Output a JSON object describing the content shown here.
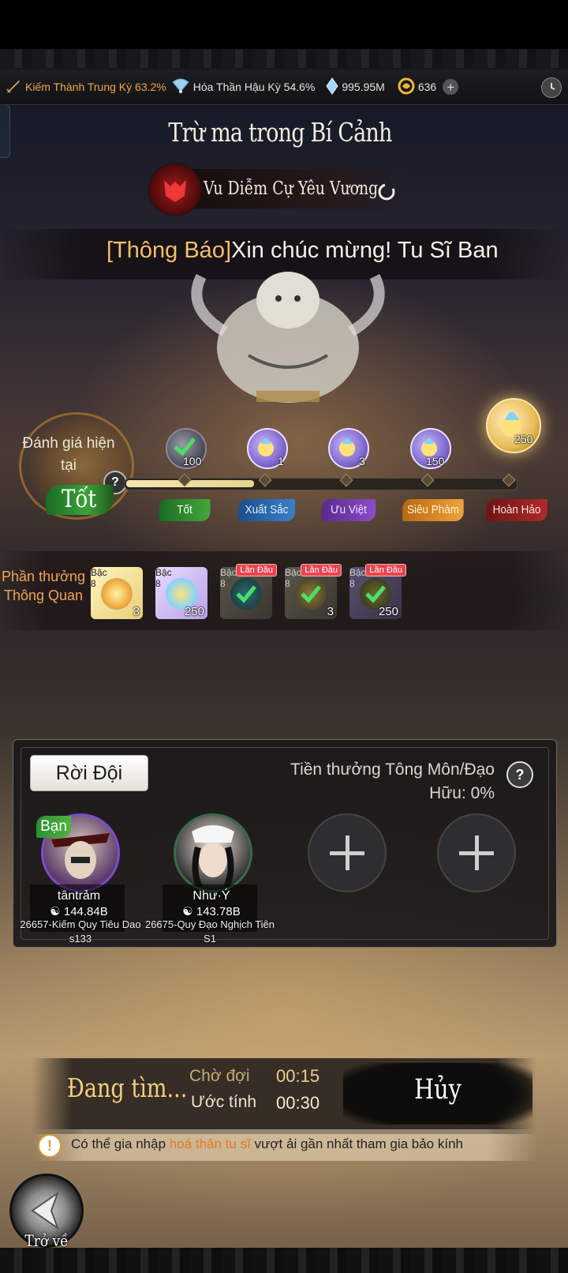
{
  "status": {
    "realm_1": "Kiếm Thành Trung Kỳ 63.2%",
    "realm_2": "Hóa Thần Hậu Kỳ 54.6%",
    "crystals": "995.95M",
    "coins": "636",
    "icons": [
      "sword-icon",
      "fan-icon",
      "crystal-icon",
      "coin-icon",
      "plus-icon",
      "clock-icon"
    ]
  },
  "title": "Trừ ma trong Bí Cảnh",
  "boss": {
    "name": "Vu Diễm Cự Yêu Vương"
  },
  "announcement": {
    "tag": "[Thông Báo]",
    "text": "Xin chúc mừng! Tu Sĩ Ban"
  },
  "rating": {
    "label": "Đánh giá hiện tại",
    "value": "Tốt",
    "progress_fraction": 0.33,
    "tiers": [
      "Tốt",
      "Xuất Sắc",
      "Ưu Việt",
      "Siêu Phàm",
      "Hoàn Hảo"
    ],
    "tier_rewards": [
      "100",
      "1",
      "3",
      "150",
      "250"
    ]
  },
  "clear_rewards": {
    "label": "Phần thưởng Thông Quan",
    "items": [
      {
        "tier": "Bậc 8",
        "count": "3",
        "first": ""
      },
      {
        "tier": "Bậc 8",
        "count": "250",
        "first": ""
      },
      {
        "tier": "Bậc 8",
        "count": "",
        "first": "Lần Đầu"
      },
      {
        "tier": "Bậc 8",
        "count": "3",
        "first": "Lần Đầu"
      },
      {
        "tier": "Bậc 8",
        "count": "250",
        "first": "Lần Đầu"
      }
    ]
  },
  "team": {
    "leave_label": "Rời Đội",
    "sect_bonus": "Tiền thưởng Tông Môn/Đạo Hữu: 0%",
    "you_tag": "Bạn",
    "members": [
      {
        "name": "tântrảm",
        "power": "144.84B",
        "server": "26657-Kiếm Quy Tiêu Dao s133"
      },
      {
        "name": "Như·Ý",
        "power": "143.78B",
        "server": "26675-Quy Đạo Nghịch Tiên S1"
      }
    ]
  },
  "search": {
    "status": "Đang tìm...",
    "wait_label": "Chờ đợi",
    "wait_value": "00:15",
    "est_label": "Ước tính",
    "est_value": "00:30",
    "cancel_label": "Hủy"
  },
  "tip": {
    "before": "Có thể gia nhập ",
    "highlight": "hoá thân tu sĩ",
    "after": " vượt ải gần nhất tham gia bảo kính"
  },
  "back_label": "Trở về",
  "colors": {
    "accent_gold": "#f2cf7c",
    "accent_orange": "#f2a35a",
    "badge_green": "#3da23a",
    "first_tag_red": "#e54650"
  }
}
